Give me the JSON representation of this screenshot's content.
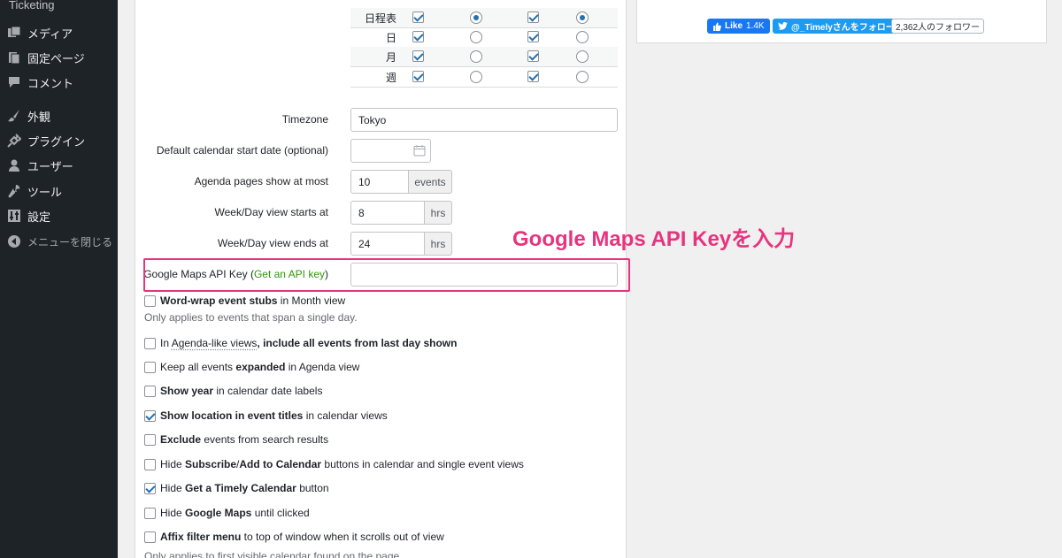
{
  "sidebar": {
    "top_item": "Ticketing",
    "items": [
      {
        "label": "メディア",
        "icon": "media-icon"
      },
      {
        "label": "固定ページ",
        "icon": "page-icon"
      },
      {
        "label": "コメント",
        "icon": "comment-icon"
      },
      {
        "label": "外観",
        "icon": "appearance-icon"
      },
      {
        "label": "プラグイン",
        "icon": "plugin-icon"
      },
      {
        "label": "ユーザー",
        "icon": "user-icon"
      },
      {
        "label": "ツール",
        "icon": "tools-icon"
      },
      {
        "label": "設定",
        "icon": "settings-icon"
      },
      {
        "label": "メニューを閉じる",
        "icon": "collapse-icon"
      }
    ]
  },
  "social": {
    "fb_label": "Like",
    "fb_count": "1.4K",
    "tw_label": "@_Timelyさんをフォロー",
    "tw_followers": "2,362人のフォロワー"
  },
  "view_table": {
    "rows": [
      {
        "label": "日程表",
        "values": [
          true,
          true,
          true,
          true
        ]
      },
      {
        "label": "日",
        "values": [
          true,
          false,
          true,
          false
        ]
      },
      {
        "label": "月",
        "values": [
          true,
          false,
          true,
          false
        ]
      },
      {
        "label": "週",
        "values": [
          true,
          false,
          true,
          false
        ]
      }
    ]
  },
  "form": {
    "timezone_label": "Timezone",
    "timezone_value": "Tokyo",
    "start_date_label": "Default calendar start date (optional)",
    "start_date_value": "",
    "agenda_label": "Agenda pages show at most",
    "agenda_value": "10",
    "agenda_unit": "events",
    "week_start_label": "Week/Day view starts at",
    "week_start_value": "8",
    "week_start_unit": "hrs",
    "week_end_label": "Week/Day view ends at",
    "week_end_value": "24",
    "week_end_unit": "hrs",
    "gmaps_label": "Google Maps API Key",
    "gmaps_paren_open": "(",
    "gmaps_link": "Get an API key",
    "gmaps_paren_close": ")",
    "gmaps_value": ""
  },
  "annotation": "Google Maps API Keyを入力",
  "options": [
    {
      "checked": false,
      "parts": [
        [
          "b",
          "Word-wrap event stubs"
        ],
        [
          "t",
          " in Month view"
        ]
      ]
    },
    {
      "checked": false,
      "parts": [
        [
          "t",
          "In "
        ],
        [
          "u",
          "Agenda-like views"
        ],
        [
          "b",
          ", include all events from last day shown"
        ]
      ]
    },
    {
      "checked": false,
      "parts": [
        [
          "t",
          "Keep all events "
        ],
        [
          "b",
          "expanded"
        ],
        [
          "t",
          " in Agenda view"
        ]
      ]
    },
    {
      "checked": false,
      "parts": [
        [
          "b",
          "Show year"
        ],
        [
          "t",
          " in calendar date labels"
        ]
      ]
    },
    {
      "checked": true,
      "parts": [
        [
          "b",
          "Show location in event titles"
        ],
        [
          "t",
          " in calendar views"
        ]
      ]
    },
    {
      "checked": false,
      "parts": [
        [
          "b",
          "Exclude"
        ],
        [
          "t",
          " events from search results"
        ]
      ]
    },
    {
      "checked": false,
      "parts": [
        [
          "t",
          "Hide "
        ],
        [
          "b",
          "Subscribe"
        ],
        [
          "t",
          "/"
        ],
        [
          "b",
          "Add to Calendar"
        ],
        [
          "t",
          " buttons in calendar and single event views"
        ]
      ]
    },
    {
      "checked": true,
      "parts": [
        [
          "t",
          "Hide "
        ],
        [
          "b",
          "Get a Timely Calendar"
        ],
        [
          "t",
          " button"
        ]
      ]
    },
    {
      "checked": false,
      "parts": [
        [
          "t",
          "Hide "
        ],
        [
          "b",
          "Google Maps"
        ],
        [
          "t",
          " until clicked"
        ]
      ]
    },
    {
      "checked": false,
      "parts": [
        [
          "b",
          "Affix filter menu"
        ],
        [
          "t",
          " to top of window when it scrolls out of view"
        ]
      ]
    }
  ],
  "notes": {
    "wordwrap": "Only applies to events that span a single day.",
    "affix": "Only applies to first visible calendar found on the page."
  },
  "colors": {
    "accent": "#2271b1",
    "highlight": "#e6347f",
    "link": "#2e9a0a",
    "sidebar_bg": "#1d2327"
  }
}
